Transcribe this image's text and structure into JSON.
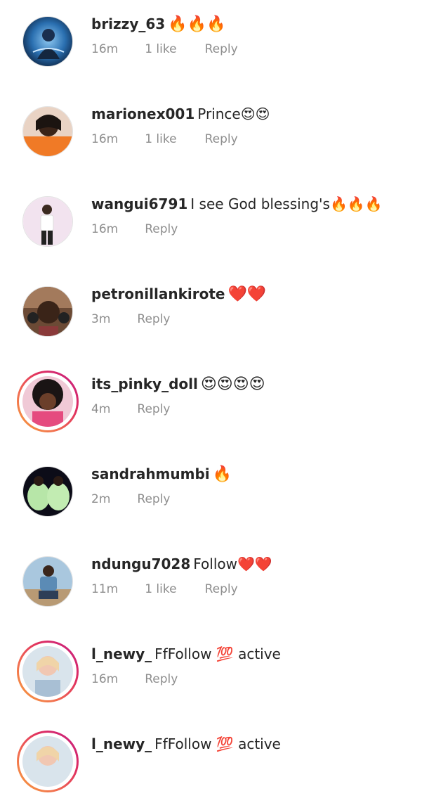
{
  "comments": [
    {
      "username": "brizzy_63",
      "text": "🔥🔥🔥",
      "time": "16m",
      "likes": "1 like",
      "reply": "Reply",
      "story": false
    },
    {
      "username": "marionex001",
      "text": "Prince😍😍",
      "time": "16m",
      "likes": "1 like",
      "reply": "Reply",
      "story": false
    },
    {
      "username": "wangui6791",
      "text": "I see God blessing's🔥🔥🔥",
      "time": "16m",
      "likes": "",
      "reply": "Reply",
      "story": false
    },
    {
      "username": "petronillankirote",
      "text": "❤️❤️",
      "time": "3m",
      "likes": "",
      "reply": "Reply",
      "story": false
    },
    {
      "username": "its_pinky_doll",
      "text": "😍😍😍😍",
      "time": "4m",
      "likes": "",
      "reply": "Reply",
      "story": true
    },
    {
      "username": "sandrahmumbi",
      "text": "🔥",
      "time": "2m",
      "likes": "",
      "reply": "Reply",
      "story": false
    },
    {
      "username": "ndungu7028",
      "text": "Follow❤️❤️",
      "time": "11m",
      "likes": "1 like",
      "reply": "Reply",
      "story": false
    },
    {
      "username": "l_newy_",
      "text": "FfFollow 💯 active",
      "time": "16m",
      "likes": "",
      "reply": "Reply",
      "story": true
    },
    {
      "username": "l_newy_",
      "text": "FfFollow 💯 active",
      "time": "",
      "likes": "",
      "reply": "",
      "story": true
    }
  ],
  "colors": {
    "username": "#262626",
    "meta": "#8e8e8e",
    "ring_start": "#f7a13a",
    "ring_end": "#c31e86"
  }
}
